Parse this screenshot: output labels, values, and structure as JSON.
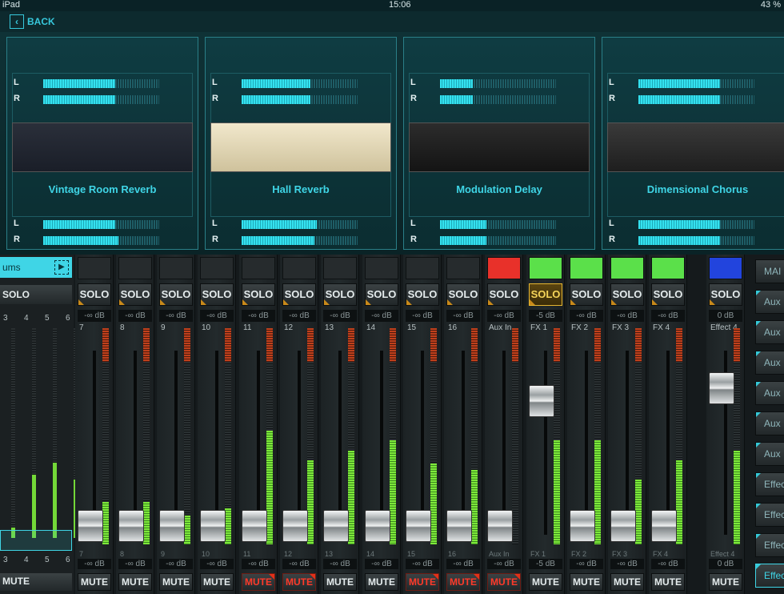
{
  "status_bar": {
    "device": "iPad",
    "time": "15:06",
    "battery": "43 %"
  },
  "nav": {
    "back_label": "BACK"
  },
  "fx_panels": [
    {
      "name": "Vintage Room Reverb",
      "in_l": 0.62,
      "in_r": 0.62,
      "out_l": 0.62,
      "out_r": 0.65
    },
    {
      "name": "Hall Reverb",
      "in_l": 0.59,
      "in_r": 0.59,
      "out_l": 0.65,
      "out_r": 0.63
    },
    {
      "name": "Modulation Delay",
      "in_l": 0.28,
      "in_r": 0.28,
      "out_l": 0.4,
      "out_r": 0.4
    },
    {
      "name": "Dimensional Chorus",
      "in_l": 0.7,
      "in_r": 0.7,
      "out_l": 0.7,
      "out_r": 0.7
    }
  ],
  "meter_labels": {
    "left": "L",
    "right": "R"
  },
  "group": {
    "tab_label": "ums",
    "solo_label": "SOLO",
    "mute_label": "MUTE",
    "channel_numbers": [
      "3",
      "4",
      "5",
      "6"
    ],
    "meter_levels": [
      0.05,
      0.3,
      0.36,
      0.28
    ]
  },
  "channels": [
    {
      "num": "7",
      "bottom": "7",
      "color": "",
      "solo_active": false,
      "solo_db": "-∞ dB",
      "fader_db": "-∞ dB",
      "fader": 0.12,
      "meter": 0.26,
      "mute_on": false
    },
    {
      "num": "8",
      "bottom": "8",
      "color": "",
      "solo_active": false,
      "solo_db": "-∞ dB",
      "fader_db": "-∞ dB",
      "fader": 0.12,
      "meter": 0.26,
      "mute_on": false
    },
    {
      "num": "9",
      "bottom": "9",
      "color": "",
      "solo_active": false,
      "solo_db": "-∞ dB",
      "fader_db": "-∞ dB",
      "fader": 0.12,
      "meter": 0.18,
      "mute_on": false
    },
    {
      "num": "10",
      "bottom": "10",
      "color": "",
      "solo_active": false,
      "solo_db": "-∞ dB",
      "fader_db": "-∞ dB",
      "fader": 0.12,
      "meter": 0.22,
      "mute_on": false
    },
    {
      "num": "11",
      "bottom": "11",
      "color": "",
      "solo_active": false,
      "solo_db": "-∞ dB",
      "fader_db": "-∞ dB",
      "fader": 0.12,
      "meter": 0.7,
      "mute_on": true
    },
    {
      "num": "12",
      "bottom": "12",
      "color": "",
      "solo_active": false,
      "solo_db": "-∞ dB",
      "fader_db": "-∞ dB",
      "fader": 0.12,
      "meter": 0.52,
      "mute_on": true
    },
    {
      "num": "13",
      "bottom": "13",
      "color": "",
      "solo_active": false,
      "solo_db": "-∞ dB",
      "fader_db": "-∞ dB",
      "fader": 0.12,
      "meter": 0.58,
      "mute_on": false
    },
    {
      "num": "14",
      "bottom": "14",
      "color": "",
      "solo_active": false,
      "solo_db": "-∞ dB",
      "fader_db": "-∞ dB",
      "fader": 0.12,
      "meter": 0.64,
      "mute_on": false
    },
    {
      "num": "15",
      "bottom": "15",
      "color": "",
      "solo_active": false,
      "solo_db": "-∞ dB",
      "fader_db": "-∞ dB",
      "fader": 0.12,
      "meter": 0.5,
      "mute_on": true
    },
    {
      "num": "16",
      "bottom": "16",
      "color": "",
      "solo_active": false,
      "solo_db": "-∞ dB",
      "fader_db": "-∞ dB",
      "fader": 0.12,
      "meter": 0.46,
      "mute_on": true
    },
    {
      "num": "Aux In",
      "bottom": "Aux In",
      "color": "#e8312a",
      "solo_active": false,
      "solo_db": "-∞ dB",
      "fader_db": "-∞ dB",
      "fader": 0.12,
      "meter": 0.0,
      "mute_on": true
    },
    {
      "num": "FX 1",
      "bottom": "FX 1",
      "color": "#5be04a",
      "solo_active": true,
      "solo_db": "-5 dB",
      "fader_db": "-5 dB",
      "fader": 0.72,
      "meter": 0.64,
      "mute_on": false
    },
    {
      "num": "FX 2",
      "bottom": "FX 2",
      "color": "#5be04a",
      "solo_active": false,
      "solo_db": "-∞ dB",
      "fader_db": "-∞ dB",
      "fader": 0.12,
      "meter": 0.64,
      "mute_on": false
    },
    {
      "num": "FX 3",
      "bottom": "FX 3",
      "color": "#5be04a",
      "solo_active": false,
      "solo_db": "-∞ dB",
      "fader_db": "-∞ dB",
      "fader": 0.12,
      "meter": 0.4,
      "mute_on": false
    },
    {
      "num": "FX 4",
      "bottom": "FX 4",
      "color": "#5be04a",
      "solo_active": false,
      "solo_db": "-∞ dB",
      "fader_db": "-∞ dB",
      "fader": 0.12,
      "meter": 0.52,
      "mute_on": false
    },
    {
      "num": "Effect 4",
      "bottom": "Effect 4",
      "color": "#2244dd",
      "solo_active": false,
      "solo_db": "0 dB",
      "fader_db": "0 dB",
      "fader": 0.78,
      "meter": 0.58,
      "mute_on": false
    }
  ],
  "channel_labels": {
    "solo": "SOLO",
    "mute": "MUTE"
  },
  "right_buttons": [
    "MAI",
    "Aux",
    "Aux",
    "Aux",
    "Aux",
    "Aux",
    "Aux",
    "Effec",
    "Effec",
    "Effec",
    "Effec"
  ]
}
